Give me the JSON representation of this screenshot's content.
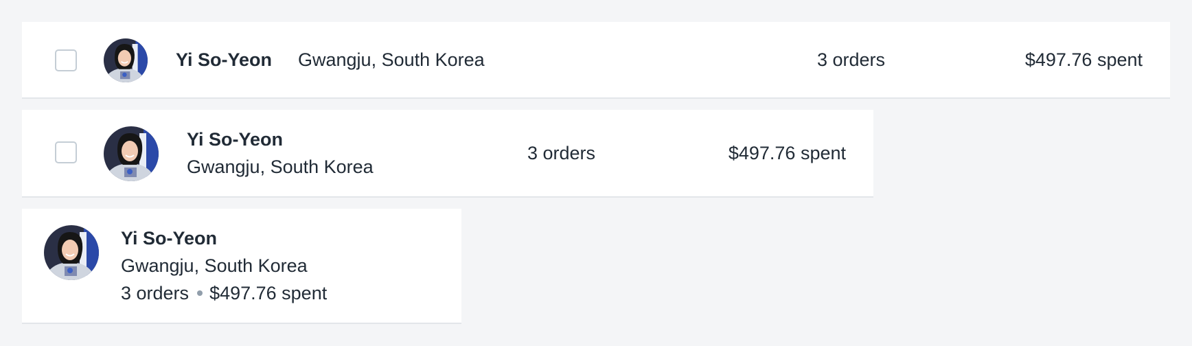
{
  "variants": {
    "wide": {
      "name": "Yi So-Yeon",
      "location": "Gwangju, South Korea",
      "orders": "3 orders",
      "spent": "$497.76 spent"
    },
    "medium": {
      "name": "Yi So-Yeon",
      "location": "Gwangju, South Korea",
      "orders": "3 orders",
      "spent": "$497.76 spent"
    },
    "compact": {
      "name": "Yi So-Yeon",
      "location": "Gwangju, South Korea",
      "orders": "3 orders",
      "spent": "$497.76 spent"
    }
  },
  "avatar": {
    "icon": "avatar-photo",
    "alt": ""
  },
  "colors": {
    "page_bg": "#f4f5f7",
    "card_bg": "#ffffff",
    "text": "#212b36",
    "checkbox_border": "#c4cdd5",
    "separator_dot": "#919eab"
  }
}
